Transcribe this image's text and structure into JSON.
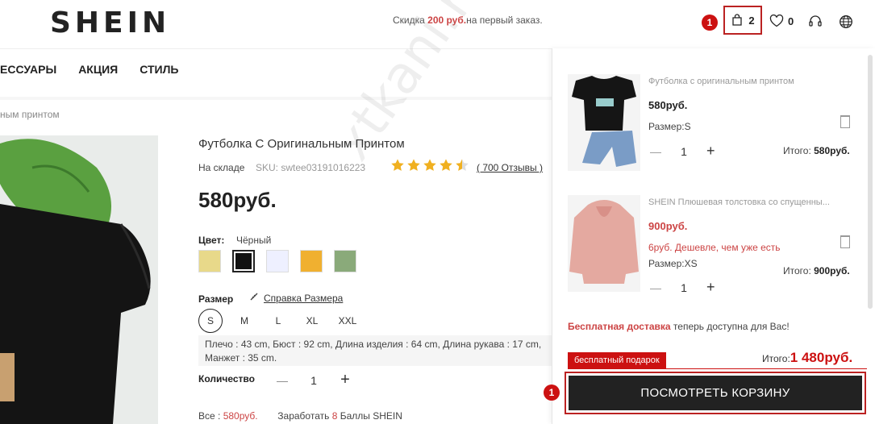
{
  "header": {
    "logo": "SHEIN",
    "promo_prefix": "Скидка ",
    "promo_amount": "200 руб.",
    "promo_suffix": "на первый заказ.",
    "cart_count": "2",
    "wishlist_count": "0",
    "marker_top": "1"
  },
  "nav": {
    "items": [
      "ЕССУАРЫ",
      "АКЦИЯ",
      "СТИЛЬ"
    ]
  },
  "breadcrumb": "ным принтом",
  "product": {
    "title": "Футболка С Оригинальным Принтом",
    "stock": "На складе",
    "sku": "SKU: swtee03191016223",
    "rating": 4.5,
    "reviews": "( 700 Отзывы )",
    "price": "580руб.",
    "color_label": "Цвет:",
    "color_value": "Чёрный",
    "swatches": [
      "#e8d98a",
      "#111111",
      "#eef0ff",
      "#f0b030",
      "#8aaa7a"
    ],
    "size_label": "Размер",
    "size_guide": "Справка Размера",
    "sizes": [
      "S",
      "M",
      "L",
      "XL",
      "XXL"
    ],
    "selected_size": "S",
    "measurements_1": "Плечо : 43 cm,  Бюст : 92 cm,  Длина изделия : 64 cm,  Длина рукава : 17 cm,",
    "measurements_2": "Манжет : 35 cm.",
    "qty_label": "Количество",
    "qty_minus": "—",
    "qty_value": "1",
    "qty_plus": "+",
    "total_prefix": "Все : ",
    "total_value": "580руб.",
    "earn_prefix": "Заработать ",
    "earn_points": "8",
    "earn_suffix": " Баллы SHEIN"
  },
  "watermark": "xtkani.ru",
  "cart": {
    "items": [
      {
        "name": "Футболка с оригинальным принтом",
        "price": "580руб.",
        "size": "Размер:S",
        "qty": "1",
        "total_label": "Итого: ",
        "total": "580руб."
      },
      {
        "name": "SHEIN Плюшевая толстовка со спущенны...",
        "price": "900руб.",
        "discount": "6руб. Дешевле, чем уже есть",
        "size": "Размер:XS",
        "qty": "1",
        "total_label": "Итого: ",
        "total": "900руб."
      }
    ],
    "free_ship_bold": "Бесплатная доставка",
    "free_ship_rest": " теперь доступна для Вас!",
    "gift": "бесплатный подарок",
    "grand_label": "Итого:",
    "grand_total": "1 480руб.",
    "view_cart": "ПОСМОТРЕТЬ КОРЗИНУ",
    "marker_bottom": "1"
  },
  "colors": {
    "accent": "#c11111",
    "price_red": "#c44444"
  }
}
